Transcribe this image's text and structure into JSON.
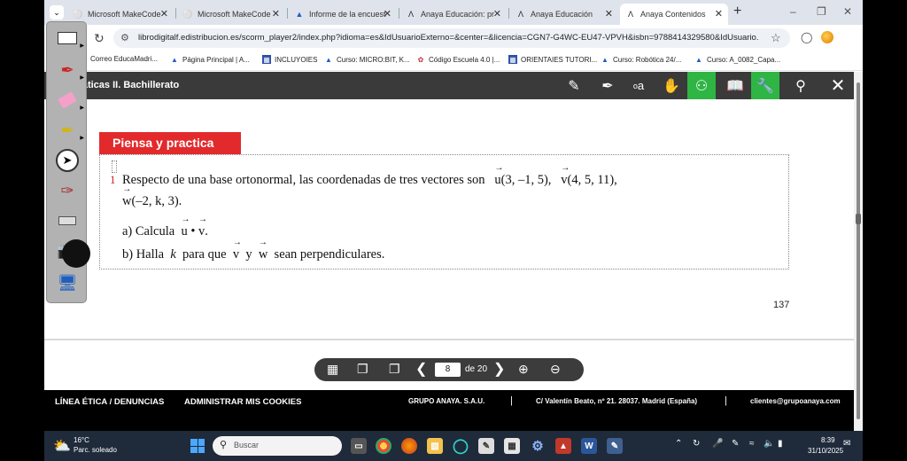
{
  "browser": {
    "tabs": [
      {
        "title": "Microsoft MakeCode",
        "icon": "makecode-icon"
      },
      {
        "title": "Microsoft MakeCode",
        "icon": "makecode-icon"
      },
      {
        "title": "Informe de la encuest",
        "icon": "graduation-cap-icon"
      },
      {
        "title": "Anaya Educación: pr",
        "icon": "anaya-icon"
      },
      {
        "title": "Anaya Educación",
        "icon": "anaya-icon"
      },
      {
        "title": "Anaya Contenidos",
        "icon": "anaya-icon"
      }
    ],
    "url": "librodigitalf.edistribucion.es/scorm_player2/index.php?idioma=es&IdUsuarioExterno=&center=&licencia=CGN7-G4WC-EU47-VPVH&isbn=9788414329580&IdUsuario...",
    "bookmarks": [
      {
        "label": "Correo EducaMadri...",
        "icon": "mail-icon"
      },
      {
        "label": "Página Principal | A...",
        "icon": "graduation-cap-icon"
      },
      {
        "label": "INCLUYOIES",
        "icon": "calendar-icon"
      },
      {
        "label": "Curso: MICRO:BIT, K...",
        "icon": "graduation-cap-icon"
      },
      {
        "label": "Código Escuela 4.0 |...",
        "icon": "code-icon"
      },
      {
        "label": "ORIENTAIES TUTORI...",
        "icon": "calendar-icon"
      },
      {
        "label": "Curso: Robótica 24/...",
        "icon": "graduation-cap-icon"
      },
      {
        "label": "Curso: A_0082_Capa...",
        "icon": "graduation-cap-icon"
      }
    ]
  },
  "app": {
    "book_title": "Matemáticas II. Bachillerato",
    "tool_text": "a",
    "tool_text_small": "o"
  },
  "exercise": {
    "section_label": "Piensa y practica",
    "number": "1",
    "line1_text": "Respecto de una base ortonormal, las coordenadas de tres vectores son",
    "u_name": "u",
    "u_coords": "(3, –1, 5),",
    "v_name": "v",
    "v_coords": "(4, 5, 11),",
    "w_name": "w",
    "w_coords": "(–2, k, 3).",
    "part_a_prefix": "a) Calcula",
    "dot": "•",
    "period": ".",
    "part_b_prefix": "b) Halla",
    "k": "k",
    "part_b_mid": "para que",
    "y": "y",
    "part_b_suffix": "sean perpendiculares."
  },
  "page": {
    "number": "137",
    "current": "8",
    "total": "de 20"
  },
  "footer": {
    "ethics": "LÍNEA ÉTICA / DENUNCIAS",
    "cookies": "ADMINISTRAR MIS COOKIES",
    "company": "GRUPO ANAYA. S.A.U.",
    "address": "C/ Valentín Beato, nº 21. 28037. Madrid (España)",
    "email": "clientes@grupoanaya.com",
    "sep": "|"
  },
  "taskbar": {
    "temperature": "16°C",
    "weather": "Parc. soleado",
    "search_placeholder": "Buscar",
    "time": "8:39",
    "date": "31/10/2025",
    "word_label": "W"
  },
  "colors": {
    "section_red": "#e22a2c",
    "tool_green": "#2fb544",
    "header_dark": "#3a3a3a"
  }
}
